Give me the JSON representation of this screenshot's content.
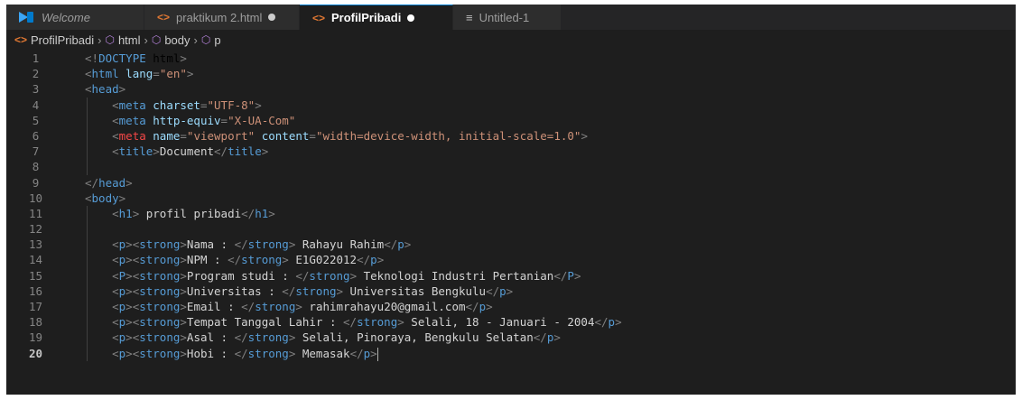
{
  "tabs": [
    {
      "label": "Welcome",
      "icon": "vscode-logo-icon",
      "italic": true
    },
    {
      "label": "praktikum 2.html",
      "icon": "html-file-icon",
      "modified": true
    },
    {
      "label": "ProfilPribadi",
      "icon": "html-file-icon",
      "modified": true,
      "active": true
    },
    {
      "label": "Untitled-1",
      "icon": "text-file-icon"
    }
  ],
  "breadcrumb": [
    "ProfilPribadi",
    "html",
    "body",
    "p"
  ],
  "editor": {
    "current_line": 20,
    "lines": [
      {
        "n": "1",
        "code": "<!DOCTYPE html>"
      },
      {
        "n": "2",
        "code": "<html lang=\"en\">"
      },
      {
        "n": "3",
        "code": "<head>"
      },
      {
        "n": "4",
        "code": "    <meta charset=\"UTF-8\">"
      },
      {
        "n": "5",
        "code": "    <meta http-equiv=\"X-UA-Com\""
      },
      {
        "n": "6",
        "code": "    <meta name=\"viewport\" content=\"width=device-width, initial-scale=1.0\">"
      },
      {
        "n": "7",
        "code": "    <title>Document</title>"
      },
      {
        "n": "8",
        "code": ""
      },
      {
        "n": "9",
        "code": "</head>"
      },
      {
        "n": "10",
        "code": "<body>"
      },
      {
        "n": "11",
        "code": "    <h1> profil pribadi</h1>"
      },
      {
        "n": "12",
        "code": ""
      },
      {
        "n": "13",
        "code": "    <p><strong>Nama : </strong> Rahayu Rahim</p>"
      },
      {
        "n": "14",
        "code": "    <p><strong>NPM : </strong> E1G022012</p>"
      },
      {
        "n": "15",
        "code": "    <P><strong>Program studi : </strong> Teknologi Industri Pertanian</P>"
      },
      {
        "n": "16",
        "code": "    <p><strong>Universitas : </strong> Universitas Bengkulu</p>"
      },
      {
        "n": "17",
        "code": "    <p><strong>Email : </strong> rahimrahayu20@gmail.com</p>"
      },
      {
        "n": "18",
        "code": "    <p><strong>Tempat Tanggal Lahir : </strong> Selali, 18 - Januari - 2004</p>"
      },
      {
        "n": "19",
        "code": "    <p><strong>Asal : </strong> Selali, Pinoraya, Bengkulu Selatan</p>"
      },
      {
        "n": "20",
        "code": "    <p><strong>Hobi : </strong> Memasak</p>"
      }
    ]
  },
  "colors": {
    "editor_bg": "#1e1e1e",
    "tag": "#569cd6",
    "attribute": "#9cdcfe",
    "string": "#ce9178",
    "text": "#d4d4d4",
    "punctuation": "#808080"
  }
}
